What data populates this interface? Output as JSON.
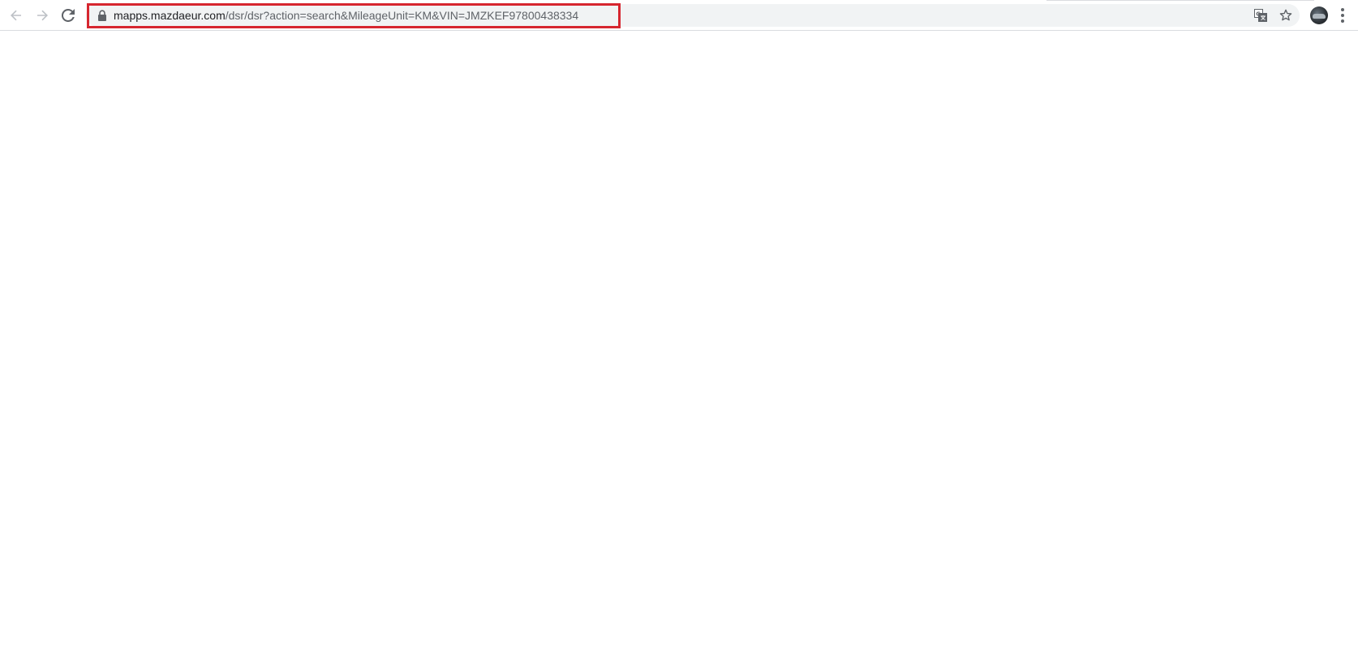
{
  "browser": {
    "address_bar": {
      "url_host": "mapps.mazdaeur.com",
      "url_path": "/dsr/dsr?action=search&MileageUnit=KM&VIN=JMZKEF97800438334",
      "highlight_color": "#d6262f"
    },
    "icons": {
      "back": "back-arrow-icon",
      "forward": "forward-arrow-icon",
      "reload": "reload-icon",
      "lock": "lock-icon",
      "translate": "translate-icon",
      "bookmark": "star-icon",
      "profile": "avatar",
      "menu": "kebab-menu-icon"
    }
  },
  "page": {
    "content": ""
  }
}
